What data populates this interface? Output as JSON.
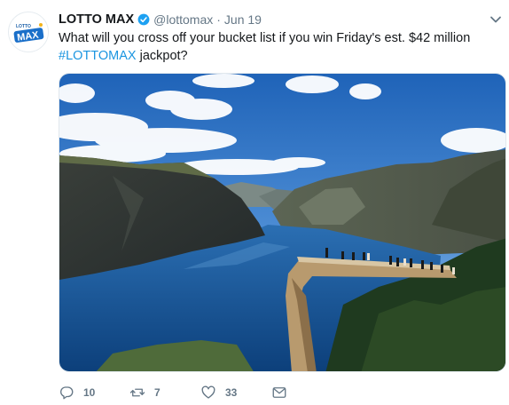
{
  "tweet": {
    "display_name": "LOTTO MAX",
    "handle": "@lottomax",
    "separator": "·",
    "date": "Jun 19",
    "text_line1": "What will you cross off your bucket list if you win Friday's est. $42 million",
    "hashtag": "#LOTTOMAX",
    "text_line2_rest": " jackpot?",
    "avatar_logo_text": "MAX",
    "avatar_small_text": "LOTTO"
  },
  "actions": {
    "reply_count": "10",
    "retweet_count": "7",
    "like_count": "33"
  },
  "icons": {
    "verified": "verified-badge-icon",
    "caret": "chevron-down-icon",
    "reply": "reply-icon",
    "retweet": "retweet-icon",
    "like": "heart-icon",
    "dm": "envelope-icon"
  },
  "colors": {
    "link": "#1b95e0",
    "verified": "#1da1f2",
    "muted": "#657786"
  }
}
